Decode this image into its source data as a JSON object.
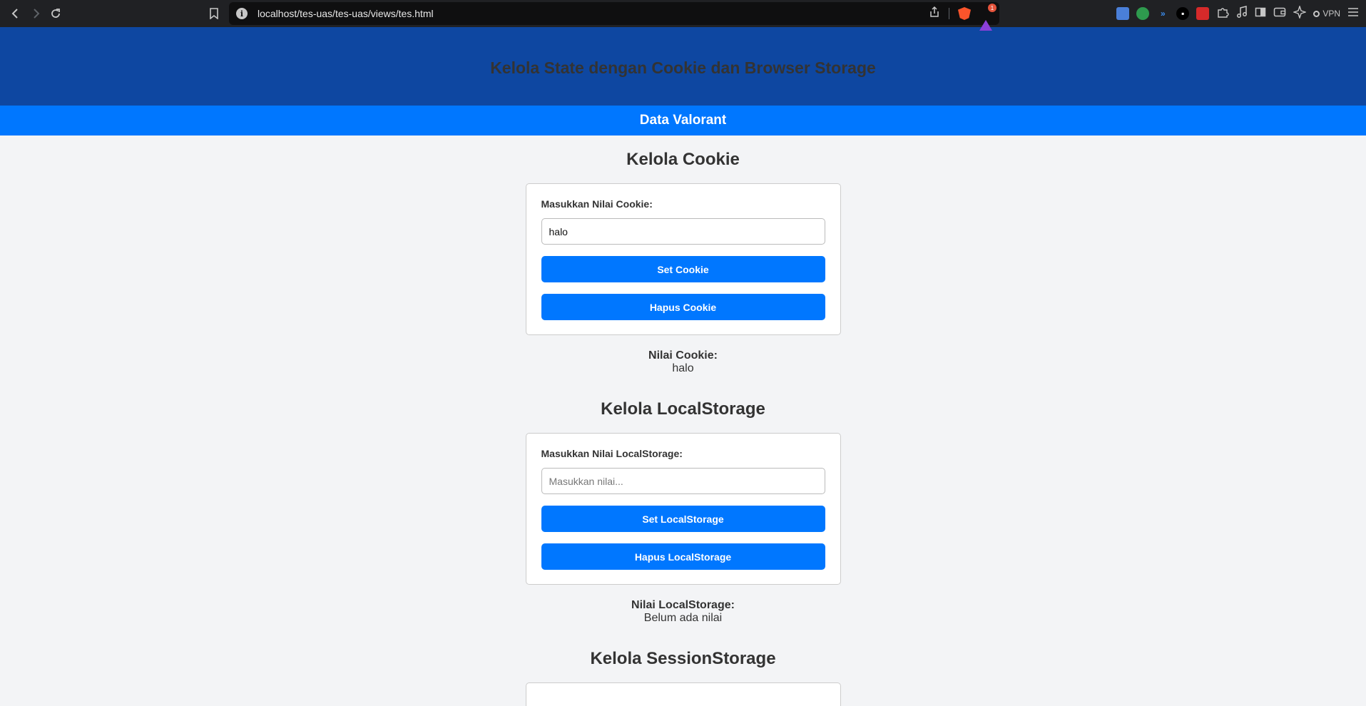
{
  "browser": {
    "url": "localhost/tes-uas/tes-uas/views/tes.html",
    "rewards_badge": "1",
    "vpn_label": "VPN",
    "icons": [
      "back-icon",
      "forward-icon",
      "reload-icon",
      "bookmark-icon",
      "info-icon",
      "share-icon",
      "brave-shield-icon",
      "brave-rewards-icon",
      "extension-icons",
      "puzzle-icon",
      "music-icon",
      "sidebar-icon",
      "wallet-icon",
      "leo-icon",
      "menu-icon"
    ]
  },
  "header": {
    "title": "Kelola State dengan Cookie dan Browser Storage"
  },
  "subbar": {
    "title": "Data Valorant"
  },
  "cookie": {
    "title": "Kelola Cookie",
    "label": "Masukkan Nilai Cookie:",
    "input_value": "halo",
    "placeholder": "Masukkan nilai...",
    "set_button": "Set Cookie",
    "delete_button": "Hapus Cookie",
    "value_label": "Nilai Cookie:",
    "value": "halo"
  },
  "localstorage": {
    "title": "Kelola LocalStorage",
    "label": "Masukkan Nilai LocalStorage:",
    "input_value": "",
    "placeholder": "Masukkan nilai...",
    "set_button": "Set LocalStorage",
    "delete_button": "Hapus LocalStorage",
    "value_label": "Nilai LocalStorage:",
    "value": "Belum ada nilai"
  },
  "sessionstorage": {
    "title": "Kelola SessionStorage"
  },
  "colors": {
    "header_bg": "#0e47a1",
    "accent": "#0077ff",
    "page_bg": "#f3f4f6"
  }
}
